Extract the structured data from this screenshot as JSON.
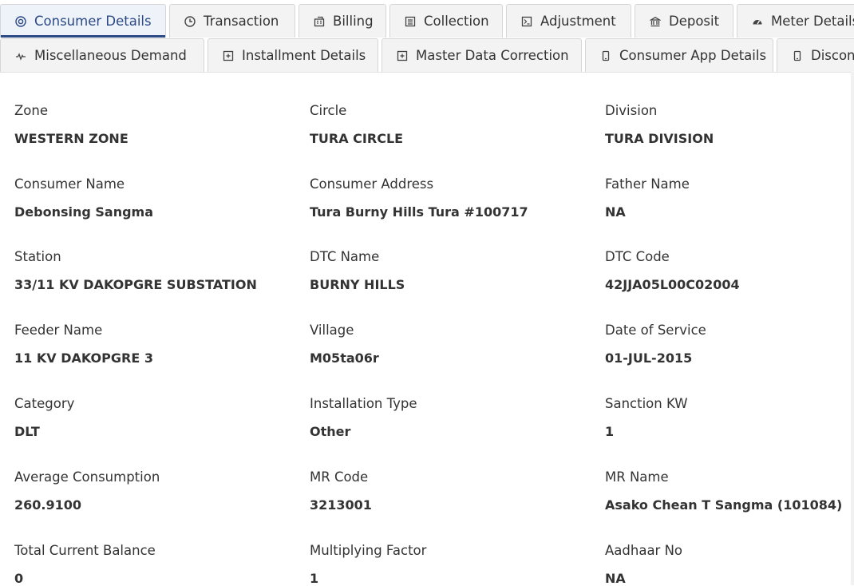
{
  "tabs_row1": [
    {
      "label": "Consumer Details",
      "icon": "target-icon",
      "active": true
    },
    {
      "label": "Transaction",
      "icon": "clock-icon"
    },
    {
      "label": "Billing",
      "icon": "calculator-icon"
    },
    {
      "label": "Collection",
      "icon": "list-icon"
    },
    {
      "label": "Adjustment",
      "icon": "terminal-icon"
    },
    {
      "label": "Deposit",
      "icon": "bank-icon"
    },
    {
      "label": "Meter Details",
      "icon": "gauge-icon"
    }
  ],
  "tabs_row2": [
    {
      "label": "Miscellaneous Demand",
      "icon": "pulse-icon"
    },
    {
      "label": "Installment Details",
      "icon": "plus-square-icon"
    },
    {
      "label": "Master Data Correction",
      "icon": "plus-square-icon"
    },
    {
      "label": "Consumer App Details",
      "icon": "mobile-icon"
    },
    {
      "label": "Disconn",
      "icon": "mobile-icon"
    }
  ],
  "fields": [
    {
      "label": "Zone",
      "value": "WESTERN ZONE"
    },
    {
      "label": "Circle",
      "value": "TURA CIRCLE"
    },
    {
      "label": "Division",
      "value": "TURA DIVISION"
    },
    {
      "label": "Consumer Name",
      "value": "Debonsing Sangma"
    },
    {
      "label": "Consumer Address",
      "value": "Tura Burny Hills Tura #100717"
    },
    {
      "label": "Father Name",
      "value": "NA"
    },
    {
      "label": "Station",
      "value": "33/11 KV DAKOPGRE SUBSTATION"
    },
    {
      "label": "DTC Name",
      "value": "BURNY HILLS"
    },
    {
      "label": "DTC Code",
      "value": "42JJA05L00C02004"
    },
    {
      "label": "Feeder Name",
      "value": "11 KV DAKOPGRE 3"
    },
    {
      "label": "Village",
      "value": "M05ta06r"
    },
    {
      "label": "Date of Service",
      "value": "01-JUL-2015"
    },
    {
      "label": "Category",
      "value": "DLT"
    },
    {
      "label": "Installation Type",
      "value": "Other"
    },
    {
      "label": "Sanction KW",
      "value": "1"
    },
    {
      "label": "Average Consumption",
      "value": "260.9100"
    },
    {
      "label": "MR Code",
      "value": "3213001"
    },
    {
      "label": "MR Name",
      "value": "Asako Chean T Sangma (101084)"
    },
    {
      "label": "Total Current Balance",
      "value": "0"
    },
    {
      "label": "Multiplying Factor",
      "value": "1"
    },
    {
      "label": "Aadhaar No",
      "value": "NA"
    }
  ]
}
